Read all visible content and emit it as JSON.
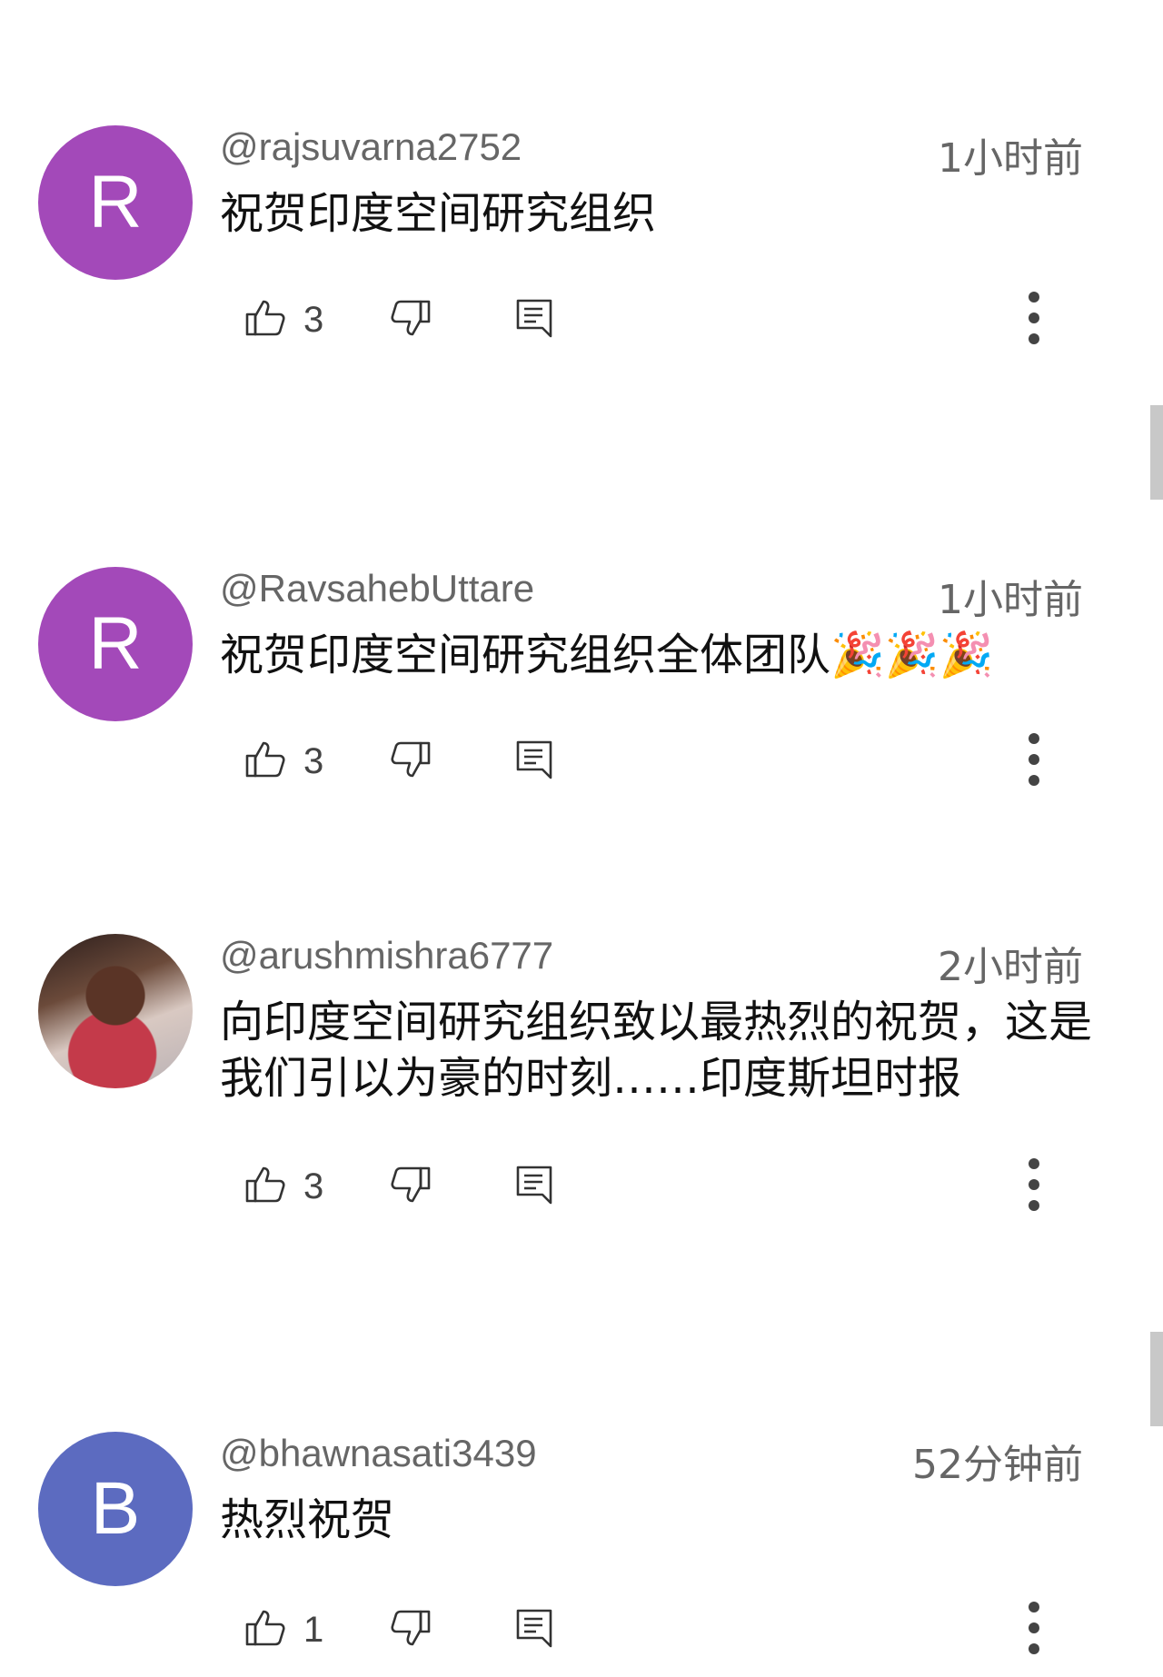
{
  "comments": [
    {
      "username": "@rajsuvarna2752",
      "timestamp": "1小时前",
      "text": "祝贺印度空间研究组织",
      "avatar_letter": "R",
      "avatar_color": "#A349B9",
      "likes": "3"
    },
    {
      "username": "@RavsahebUttare",
      "timestamp": "1小时前",
      "text": "祝贺印度空间研究组织全体团队🎉🎉🎉",
      "avatar_letter": "R",
      "avatar_color": "#A349B9",
      "likes": "3"
    },
    {
      "username": "@arushmishra6777",
      "timestamp": "2小时前",
      "text": "向印度空间研究组织致以最热烈的祝贺，这是我们引以为豪的时刻……印度斯坦时报",
      "avatar_letter": "",
      "avatar_color": "",
      "likes": "3"
    },
    {
      "username": "@bhawnasati3439",
      "timestamp": "52分钟前",
      "text": "热烈祝贺",
      "avatar_letter": "B",
      "avatar_color": "#5C6BC0",
      "likes": "1"
    }
  ],
  "icons": {
    "like": "thumb-up-icon",
    "dislike": "thumb-down-icon",
    "reply": "reply-comment-icon",
    "more": "more-vertical-icon"
  }
}
